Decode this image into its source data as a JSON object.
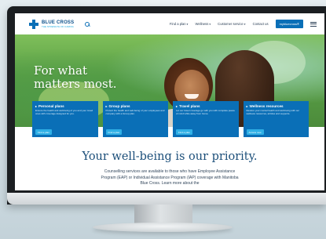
{
  "header": {
    "logo_main": "BLUE CROSS",
    "logo_sub": "THE STRENGTH OF CARING",
    "nav": [
      {
        "label": "Find a plan",
        "dropdown": true
      },
      {
        "label": "Wellness",
        "dropdown": true
      },
      {
        "label": "Customer service",
        "dropdown": true
      },
      {
        "label": "Contact us",
        "dropdown": false
      }
    ],
    "cta_label": "mybluecross®"
  },
  "hero": {
    "title_line1": "For what",
    "title_line2": "matters most."
  },
  "cards": [
    {
      "title": "Personal plans",
      "text": "Ensure the health and well-being of you and your loved ones with coverage designed for you.",
      "button": "Find a plan"
    },
    {
      "title": "Group plans",
      "text": "Protect the health and well-being of your employees and company with a Group plan.",
      "button": "Find a plan"
    },
    {
      "title": "Travel plans",
      "text": "Let our travel coverage go with you with complete peace of mind while away from home.",
      "button": "Find a plan"
    },
    {
      "title": "Wellness resources",
      "text": "Restore your mental health and well-being with our wellness resources, articles and supports.",
      "button": "Access now"
    }
  ],
  "main": {
    "headline": "Your well-being is our priority.",
    "body": "Counselling services are available to those who have Employee Assistance Program (EAP) or Individual Assistance Program (IAP) coverage with Manitoba Blue Cross. Learn more about the"
  },
  "colors": {
    "brand_blue": "#0a6fb7",
    "accent_cyan": "#2fb0e6",
    "headline_navy": "#1c4f7a"
  },
  "icons": [
    "search-icon",
    "menu-icon",
    "card-arrow-icon"
  ]
}
